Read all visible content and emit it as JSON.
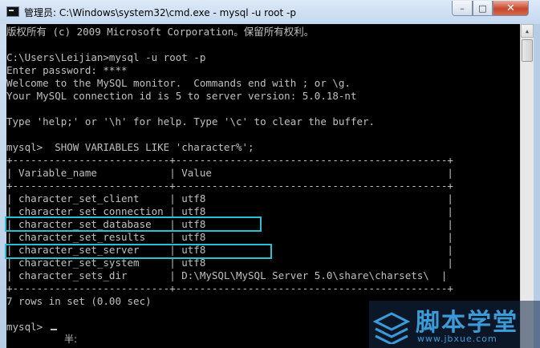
{
  "window": {
    "title": "管理员: C:\\Windows\\system32\\cmd.exe - mysql  -u root -p",
    "icon": "cmd-console-icon",
    "buttons": {
      "minimize": "–",
      "maximize": "□",
      "close": "✕"
    }
  },
  "console": {
    "lines": [
      "版权所有 (c) 2009 Microsoft Corporation。保留所有权利。",
      "",
      "C:\\Users\\Leijian>mysql -u root -p",
      "Enter password: ****",
      "Welcome to the MySQL monitor.  Commands end with ; or \\g.",
      "Your MySQL connection id is 5 to server version: 5.0.18-nt",
      "",
      "Type 'help;' or '\\h' for help. Type '\\c' to clear the buffer.",
      "",
      "mysql>  SHOW VARIABLES LIKE 'character%';",
      "+--------------------------+---------------------------------------------+",
      "| Variable_name            | Value                                       |",
      "+--------------------------+---------------------------------------------+",
      "| character_set_client     | utf8                                        |",
      "| character_set_connection | utf8                                        |",
      "| character_set_database   | utf8                                        |",
      "| character_set_results    | utf8                                        |",
      "| character_set_server     | utf8                                        |",
      "| character_set_system     | utf8                                        |",
      "| character_sets_dir       | D:\\MySQL\\MySQL Server 5.0\\share\\charsets\\  |",
      "+--------------------------+---------------------------------------------+",
      "7 rows in set (0.00 sec)",
      ""
    ],
    "prompt": "mysql>",
    "ime_status": "半:"
  },
  "watermark": {
    "name": "脚本学堂",
    "url": "www.jbxue.com"
  },
  "colors": {
    "console_bg": "#000000",
    "console_text": "#c0c0c0",
    "highlight": "#29c1d1",
    "watermark": "#3b9bd9"
  }
}
